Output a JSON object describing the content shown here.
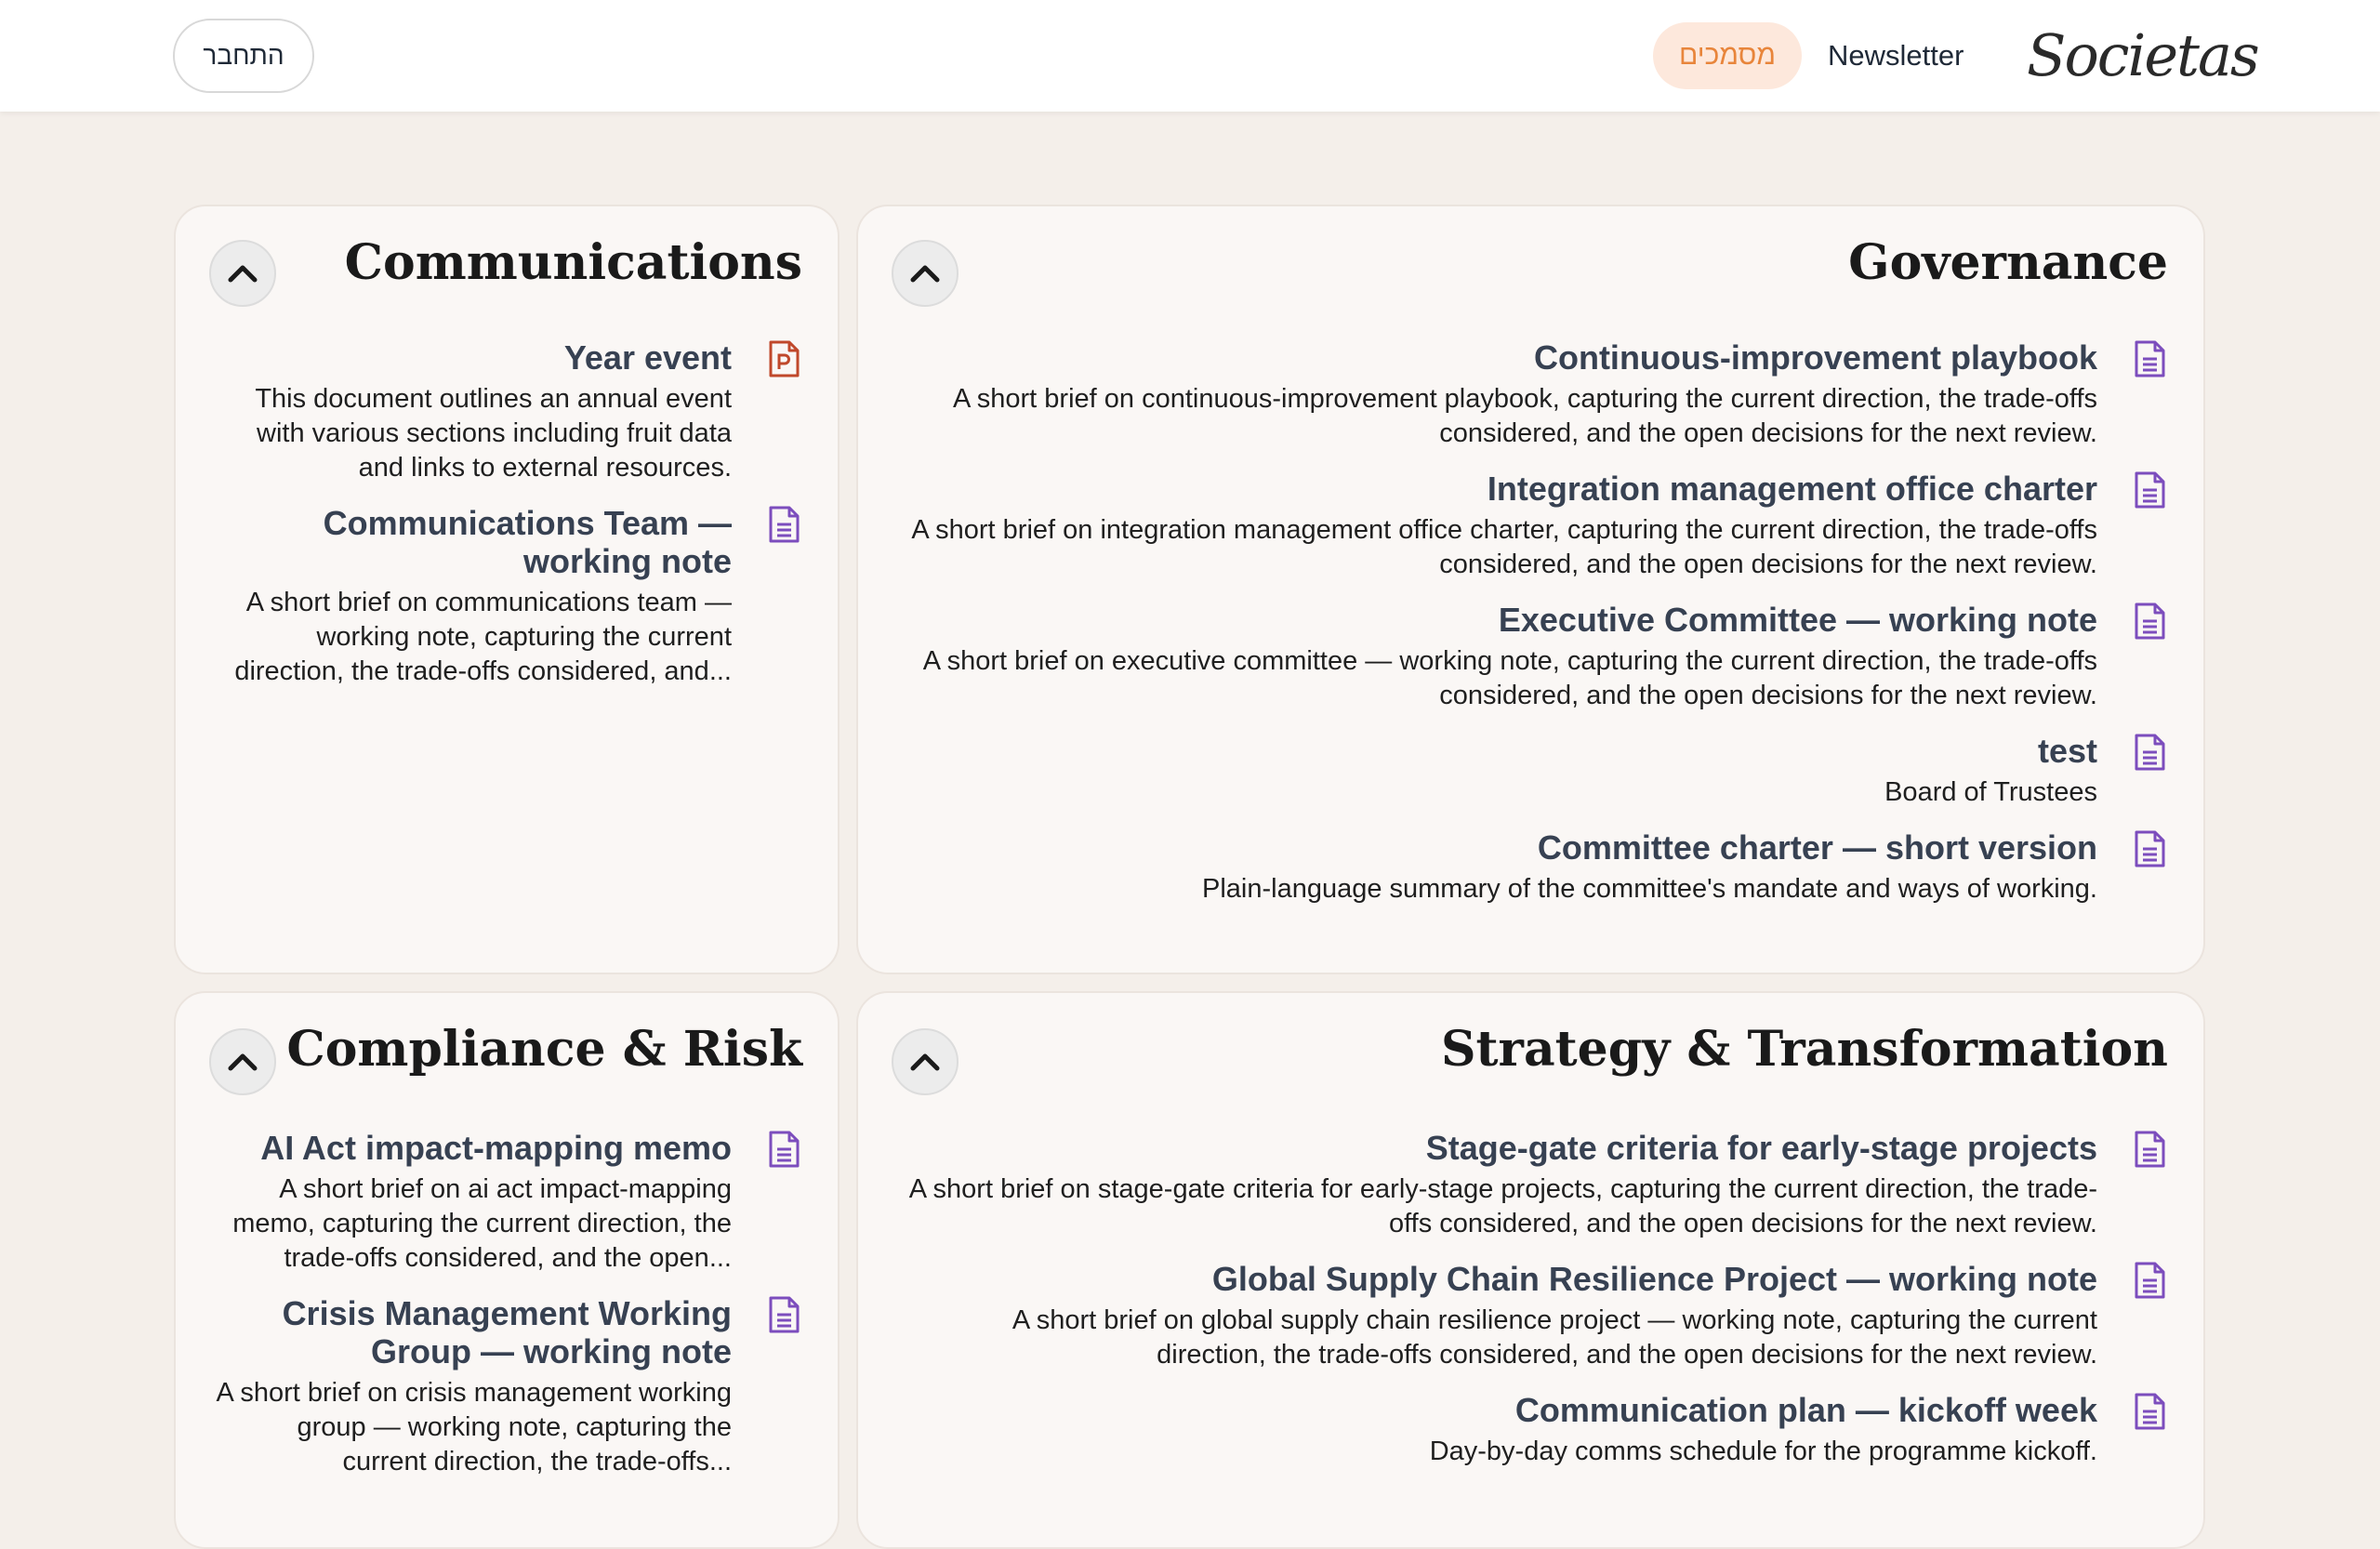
{
  "header": {
    "login_label": "התחבר",
    "nav": [
      {
        "label": "מסמכים",
        "active": true
      },
      {
        "label": "Newsletter",
        "active": false
      }
    ],
    "logo_text": "Societas"
  },
  "colors": {
    "accent": "#e8853b",
    "accent_bg": "#fde8dc",
    "doc_icon": "#7c4dbd",
    "pdf_icon": "#c0482b"
  },
  "sections": {
    "communications": {
      "title": "Communications",
      "docs": [
        {
          "icon": "presentation-file-icon",
          "title": "Year event",
          "desc": "This document outlines an annual event with various sections including fruit data and links to external resources."
        },
        {
          "icon": "document-icon",
          "title": "Communications Team — working note",
          "desc": "A short brief on communications team — working note, capturing the current direction, the trade-offs considered, and..."
        }
      ]
    },
    "governance": {
      "title": "Governance",
      "docs": [
        {
          "icon": "document-icon",
          "title": "Continuous-improvement playbook",
          "desc": "A short brief on continuous-improvement playbook, capturing the current direction, the trade-offs considered, and the open decisions for the next review."
        },
        {
          "icon": "document-icon",
          "title": "Integration management office charter",
          "desc": "A short brief on integration management office charter, capturing the current direction, the trade-offs considered, and the open decisions for the next review."
        },
        {
          "icon": "document-icon",
          "title": "Executive Committee — working note",
          "desc": "A short brief on executive committee — working note, capturing the current direction, the trade-offs considered, and the open decisions for the next review."
        },
        {
          "icon": "document-icon",
          "title": "test",
          "desc": "Board of Trustees"
        },
        {
          "icon": "document-icon",
          "title": "Committee charter — short version",
          "desc": "Plain-language summary of the committee's mandate and ways of working."
        }
      ]
    },
    "compliance": {
      "title": "Compliance & Risk",
      "docs": [
        {
          "icon": "document-icon",
          "title": "AI Act impact-mapping memo",
          "desc": "A short brief on ai act impact-mapping memo, capturing the current direction, the trade-offs considered, and the open..."
        },
        {
          "icon": "document-icon",
          "title": "Crisis Management Working Group — working note",
          "desc": "A short brief on crisis management working group — working note, capturing the current direction, the trade-offs..."
        }
      ]
    },
    "strategy": {
      "title": "Strategy & Transformation",
      "docs": [
        {
          "icon": "document-icon",
          "title": "Stage-gate criteria for early-stage projects",
          "desc": "A short brief on stage-gate criteria for early-stage projects, capturing the current direction, the trade-offs considered, and the open decisions for the next review."
        },
        {
          "icon": "document-icon",
          "title": "Global Supply Chain Resilience Project — working note",
          "desc": "A short brief on global supply chain resilience project — working note, capturing the current direction, the trade-offs considered, and the open decisions for the next review."
        },
        {
          "icon": "document-icon",
          "title": "Communication plan — kickoff week",
          "desc": "Day-by-day comms schedule for the programme kickoff."
        }
      ]
    }
  }
}
